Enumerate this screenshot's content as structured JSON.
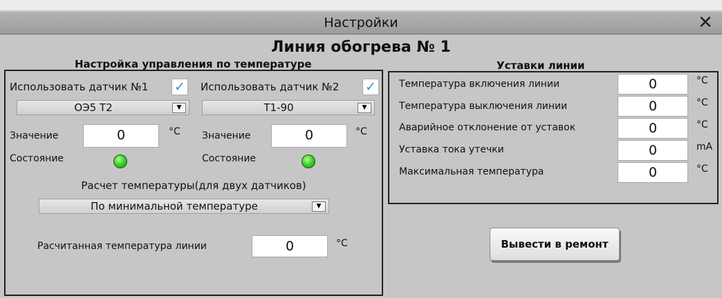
{
  "window": {
    "title": "Настройки",
    "close_symbol": "✕",
    "heading": "Линия обогрева № 1"
  },
  "temp_control": {
    "title": "Настройка управления по температуре",
    "sensor1": {
      "checkbox_label": "Использовать датчик №1",
      "checked": true,
      "type": "ОЭ5 Т2",
      "value_label": "Значение",
      "value": "0",
      "unit": "°C",
      "status_label": "Состояние",
      "status_color": "#3fd42a"
    },
    "sensor2": {
      "checkbox_label": "Использовать датчик №2",
      "checked": true,
      "type": "Т1-90",
      "value_label": "Значение",
      "value": "0",
      "unit": "°C",
      "status_label": "Состояние",
      "status_color": "#3fd42a"
    },
    "calc_label": "Расчет температуры(для двух датчиков)",
    "calc_mode": "По минимальной температуре",
    "calculated_label": "Расчитанная температура линии",
    "calculated_value": "0",
    "calculated_unit": "°C"
  },
  "setpoints": {
    "title": "Уставки линии",
    "rows": [
      {
        "label": "Температура включения линии",
        "value": "0",
        "unit": "°C"
      },
      {
        "label": "Температура выключения линии",
        "value": "0",
        "unit": "°C"
      },
      {
        "label": "Аварийное отклонение от уставок",
        "value": "0",
        "unit": "°C"
      },
      {
        "label": "Уставка тока утечки",
        "value": "0",
        "unit": "mA"
      },
      {
        "label": "Максимальная температура",
        "value": "0",
        "unit": "°C"
      }
    ]
  },
  "actions": {
    "repair_button": "Вывести в ремонт"
  },
  "icons": {
    "checkmark": "check-icon",
    "dropdown": "chevron-down-icon",
    "led": "status-led-icon",
    "close": "close-icon"
  },
  "colors": {
    "accent_check": "#3b8ee0",
    "led_ok": "#3fd42a",
    "window_bg": "#c6c6c6",
    "titlebar_bg": "#a6a6a6"
  }
}
